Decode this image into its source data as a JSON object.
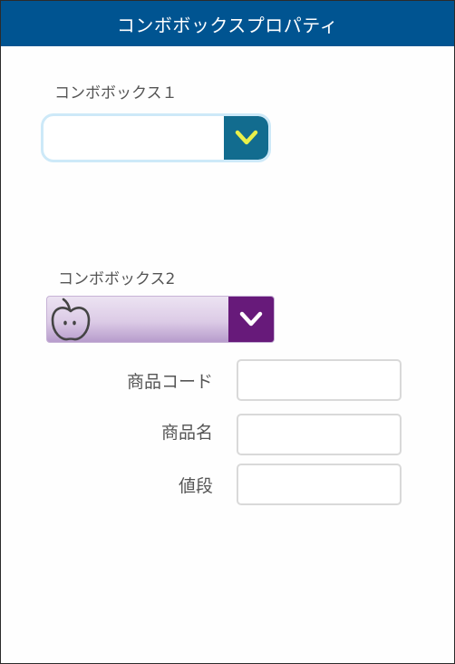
{
  "window": {
    "title": "コンボボックスプロパティ"
  },
  "combobox1": {
    "label": "コンボボックス１",
    "value": "",
    "icon": "chevron-down-icon",
    "colors": {
      "border": "#cde9f8",
      "button": "#126c8f",
      "chevron": "#e8f04a"
    }
  },
  "combobox2": {
    "label": "コンボボックス2",
    "value": "",
    "item_icon": "apple-icon",
    "icon": "chevron-down-icon",
    "colors": {
      "button": "#671a7a",
      "gradient_top": "#ece3f2",
      "gradient_bottom": "#b79ccc"
    }
  },
  "form": {
    "product_code": {
      "label": "商品コード",
      "value": "",
      "placeholder": ""
    },
    "product_name": {
      "label": "商品名",
      "value": "",
      "placeholder": ""
    },
    "price": {
      "label": "値段",
      "value": "",
      "placeholder": ""
    }
  },
  "theme": {
    "header_bg": "#005491"
  }
}
